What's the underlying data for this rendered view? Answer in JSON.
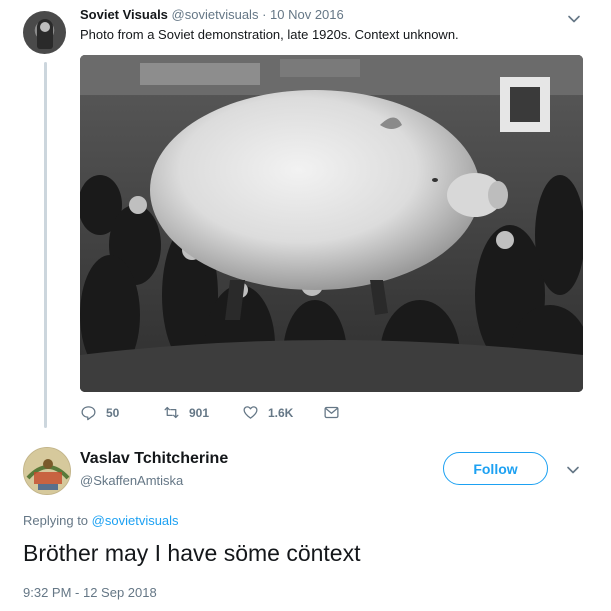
{
  "tweet": {
    "author_name": "Soviet Visuals",
    "handle": "@sovietvisuals",
    "separator": " · ",
    "date": "10 Nov 2016",
    "text": "Photo from a Soviet demonstration, late 1920s. Context unknown.",
    "actions": {
      "reply_count": "50",
      "retweet_count": "901",
      "like_count": "1.6K"
    }
  },
  "reply": {
    "author_name": "Vaslav Tchitcherine",
    "handle": "@SkaffenAmtiska",
    "follow_label": "Follow",
    "replying_prefix": "Replying to ",
    "replying_to": "@sovietvisuals",
    "text": "Bröther may I have söme cöntext",
    "timestamp": "9:32 PM - 12 Sep 2018"
  },
  "icons": [
    "reply-icon",
    "retweet-icon",
    "like-icon",
    "dm-icon",
    "chevron-down-icon"
  ],
  "colors": {
    "accent": "#1da1f2",
    "muted": "#657786",
    "text": "#14171a",
    "thread_line": "#ccd6dd"
  }
}
